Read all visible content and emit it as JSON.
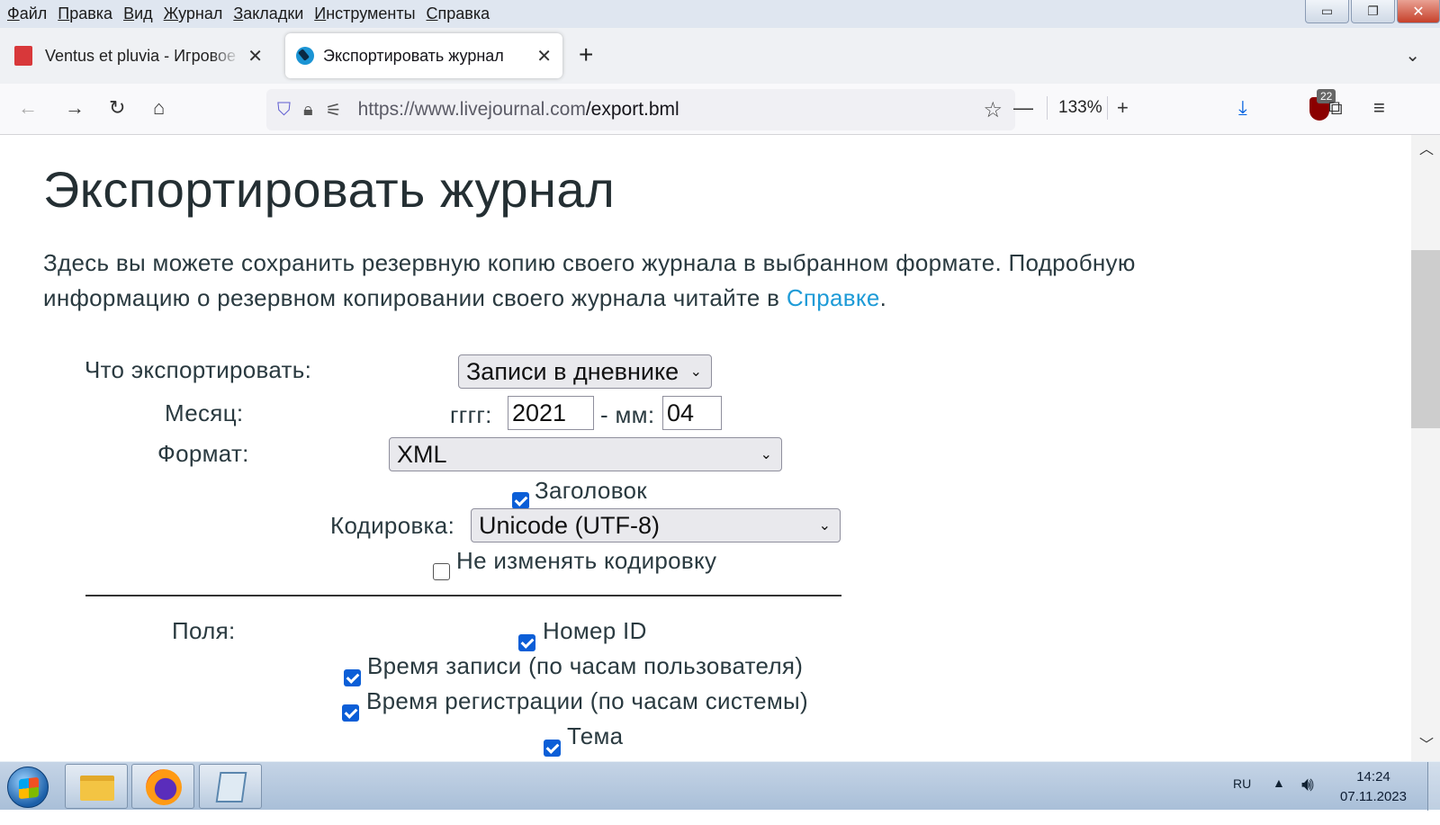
{
  "menu": [
    "Файл",
    "Правка",
    "Вид",
    "Журнал",
    "Закладки",
    "Инструменты",
    "Справка"
  ],
  "window_controls": {
    "minimize": "▭",
    "restore": "❐",
    "close": "✕"
  },
  "tabs": [
    {
      "title": "Ventus et pluvia - Игровое",
      "active": false
    },
    {
      "title": "Экспортировать журнал",
      "active": true
    }
  ],
  "tab_close_glyph": "✕",
  "new_tab_glyph": "+",
  "tab_list_glyph": "⌄",
  "nav": {
    "back": "←",
    "forward": "→",
    "reload": "↻",
    "home": "⌂",
    "url_host": "https://www.livejournal.com",
    "url_path": "/export.bml",
    "zoom_out": "—",
    "zoom_level": "133%",
    "zoom_in": "+",
    "download": "⤓",
    "ublock_count": "22",
    "extensions": "⧉",
    "menu": "≡",
    "bookmark_star": "☆"
  },
  "page": {
    "title": "Экспортировать журнал",
    "intro_text": "Здесь вы можете сохранить резервную копию своего журнала в выбранном формате. Подробную информацию о резервном копировании своего журнала читайте в ",
    "intro_link": "Справке",
    "intro_end": ".",
    "form": {
      "what_label": "Что экспортировать:",
      "what_value": "Записи в дневнике",
      "month_label": "Месяц:",
      "year_label": "гггг:",
      "year_value": "2021",
      "month_sep_label": "- мм:",
      "month_value": "04",
      "format_label": "Формат:",
      "format_value": "XML",
      "header_label": "Заголовок",
      "header_checked": true,
      "encoding_label": "Кодировка:",
      "encoding_value": "Unicode (UTF-8)",
      "keep_encoding_label": "Не изменять кодировку",
      "keep_encoding_checked": false,
      "fields_label": "Поля:",
      "fields": [
        {
          "label": "Номер ID",
          "checked": true
        },
        {
          "label": "Время записи (по часам пользователя)",
          "checked": true
        },
        {
          "label": "Время регистрации (по часам системы)",
          "checked": true
        },
        {
          "label": "Тема",
          "checked": true
        }
      ]
    }
  },
  "taskbar": {
    "language": "RU",
    "time": "14:24",
    "date": "07.11.2023"
  }
}
